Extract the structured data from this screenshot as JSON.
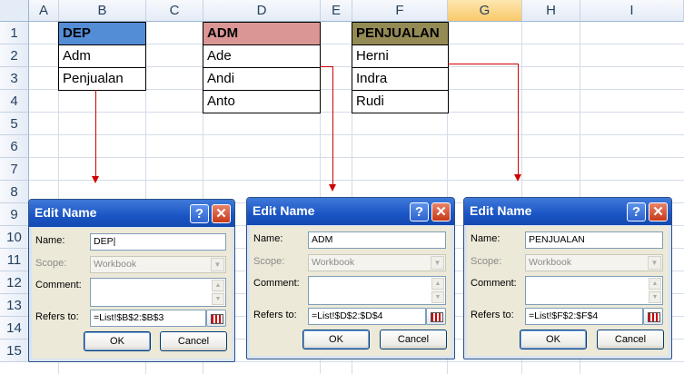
{
  "spreadsheet": {
    "columns": [
      "A",
      "B",
      "C",
      "D",
      "E",
      "F",
      "G",
      "H",
      "I"
    ],
    "selected_column": "G",
    "rows": [
      "1",
      "2",
      "3",
      "4",
      "5",
      "6",
      "7",
      "8",
      "9",
      "10",
      "11",
      "12",
      "13",
      "14",
      "15"
    ],
    "tables": [
      {
        "header": "DEP",
        "header_color": "#538dd5",
        "cells": [
          "Adm",
          "Penjualan"
        ]
      },
      {
        "header": "ADM",
        "header_color": "#da9694",
        "cells": [
          "Ade",
          "Andi",
          "Anto"
        ]
      },
      {
        "header": "PENJUALAN",
        "header_color": "#948a54",
        "cells": [
          "Herni",
          "Indra",
          "Rudi"
        ]
      }
    ]
  },
  "dialogs": [
    {
      "title": "Edit Name",
      "name_label": "Name:",
      "name_value": "DEP|",
      "scope_label": "Scope:",
      "scope_value": "Workbook",
      "comment_label": "Comment:",
      "refers_label": "Refers to:",
      "refers_value": "=List!$B$2:$B$3",
      "ok": "OK",
      "cancel": "Cancel"
    },
    {
      "title": "Edit Name",
      "name_label": "Name:",
      "name_value": "ADM",
      "scope_label": "Scope:",
      "scope_value": "Workbook",
      "comment_label": "Comment:",
      "refers_label": "Refers to:",
      "refers_value": "=List!$D$2:$D$4",
      "ok": "OK",
      "cancel": "Cancel"
    },
    {
      "title": "Edit Name",
      "name_label": "Name:",
      "name_value": "PENJUALAN",
      "scope_label": "Scope:",
      "scope_value": "Workbook",
      "comment_label": "Comment:",
      "refers_label": "Refers to:",
      "refers_value": "=List!$F$2:$F$4",
      "ok": "OK",
      "cancel": "Cancel"
    }
  ],
  "titlebar_buttons": {
    "help": "?",
    "close": "✕"
  },
  "colors": {
    "arrow": "#d00000",
    "title_bar": "#1a54c4",
    "selected_header": "#f9c86a"
  }
}
